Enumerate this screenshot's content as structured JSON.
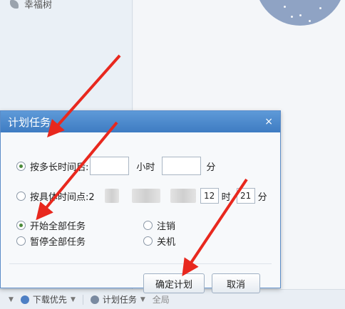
{
  "background": {
    "sidebar_item_label": "幸福树",
    "bottom_bar": {
      "download_priority": "下载优先",
      "scheduled_task": "计划任务",
      "truncated": "全局"
    }
  },
  "dialog": {
    "title": "计划任务",
    "close": "×",
    "option_duration": {
      "label": "按多长时间后:",
      "hour_unit": "小时",
      "minute_unit": "分",
      "hours_value": "",
      "minutes_value": ""
    },
    "option_time_point": {
      "label": "按具体时间点:2",
      "hour_value": "12",
      "hour_unit": "时",
      "minute_value": "21",
      "minute_unit": "分"
    },
    "actions": {
      "start_all": "开始全部任务",
      "pause_all": "暂停全部任务",
      "logout": "注销",
      "shutdown": "关机"
    },
    "buttons": {
      "confirm": "确定计划",
      "cancel": "取消"
    }
  },
  "colors": {
    "arrow": "#e8281e",
    "title_bar": "#4a87cb"
  }
}
